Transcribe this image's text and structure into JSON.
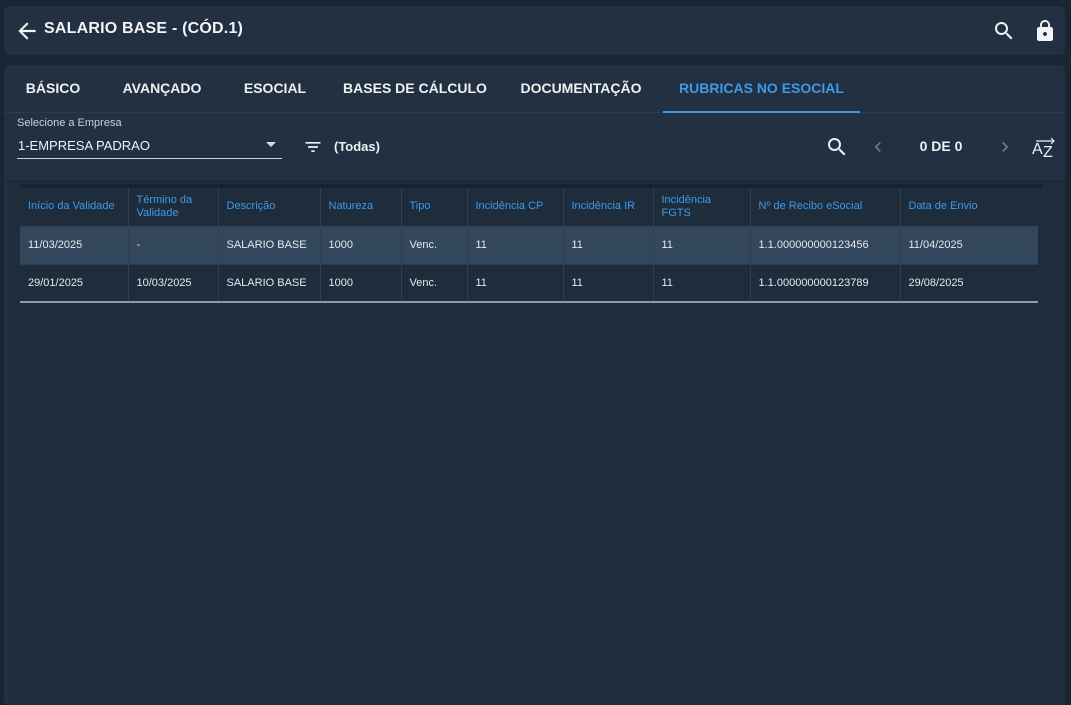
{
  "header": {
    "title": "SALARIO BASE - (CÓD.1)"
  },
  "tabs": [
    {
      "label": "BÁSICO"
    },
    {
      "label": "AVANÇADO"
    },
    {
      "label": "ESOCIAL"
    },
    {
      "label": "BASES DE CÁLCULO"
    },
    {
      "label": "DOCUMENTAÇÃO"
    },
    {
      "label": "RUBRICAS NO ESOCIAL"
    }
  ],
  "active_tab": "RUBRICAS NO ESOCIAL",
  "toolbar": {
    "empresa_label": "Selecione a Empresa",
    "empresa_value": "1-EMPRESA PADRAO",
    "filter_value": "(Todas)",
    "pager": "0 DE 0"
  },
  "table": {
    "columns": [
      "Início da Validade",
      "Término da Validade",
      "Descrição",
      "Natureza",
      "Tipo",
      "Incidência CP",
      "Incidência IR",
      "Incidência FGTS",
      "Nº de Recibo eSocial",
      "Data de Envio"
    ],
    "rows": [
      [
        "11/03/2025",
        "-",
        "SALARIO BASE",
        "1000",
        "Venc.",
        "11",
        "11",
        "11",
        "1.1.000000000123456",
        "11/04/2025"
      ],
      [
        "29/01/2025",
        "10/03/2025",
        "SALARIO BASE",
        "1000",
        "Venc.",
        "11",
        "11",
        "11",
        "1.1.000000000123789",
        "29/08/2025"
      ]
    ]
  },
  "colors": {
    "accent": "#3d9ae8",
    "background": "#1a2533",
    "panel": "#223041",
    "selected_row": "#33475c"
  }
}
